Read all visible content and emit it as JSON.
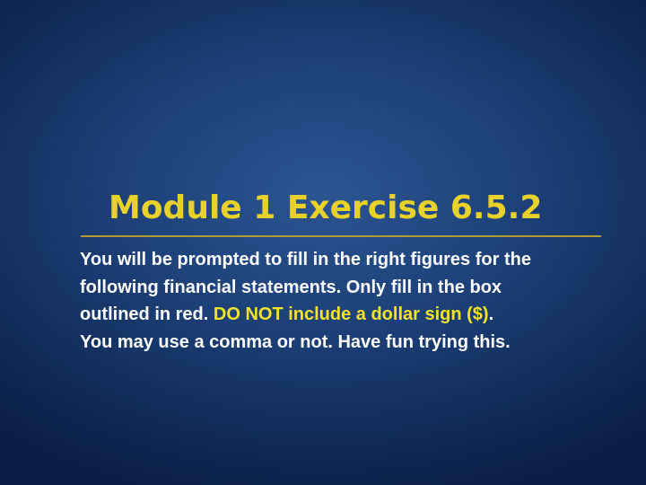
{
  "slide": {
    "title": "Module 1 Exercise 6.5.2",
    "body": {
      "line1": "You will be prompted to fill in the right figures for the",
      "line2": "following financial statements. Only fill in the box",
      "line3_prefix": "outlined in red. ",
      "line3_highlight": "DO NOT include a dollar sign ($)",
      "line3_suffix": ".",
      "line4": "You may use a comma or not. Have fun trying this."
    }
  },
  "colors": {
    "background": "#1c3f76",
    "title": "#e8d22a",
    "rule": "#b49a32",
    "body_text": "#ffffff",
    "highlight": "#f2e22a"
  }
}
